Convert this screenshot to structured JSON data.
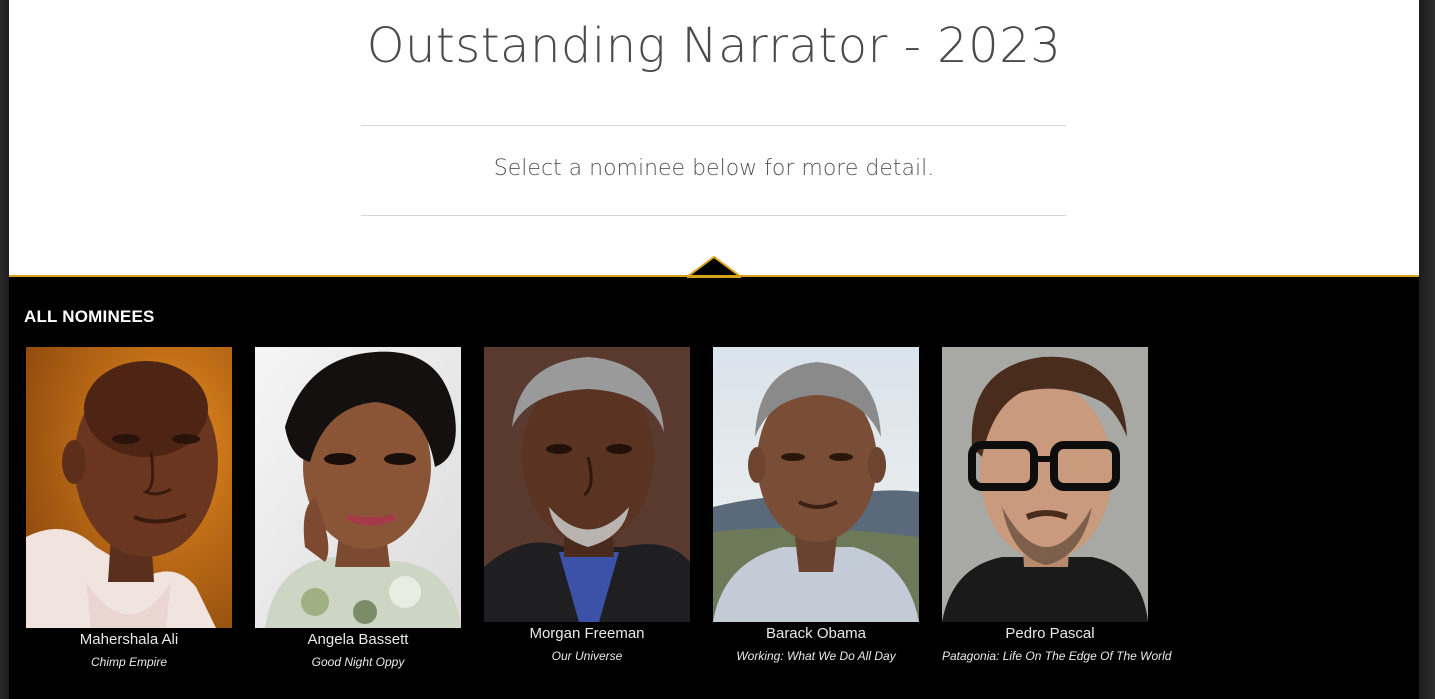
{
  "header": {
    "title": "Outstanding Narrator - 2023",
    "subtitle": "Select a nominee below for more detail."
  },
  "section": {
    "label": "ALL NOMINEES"
  },
  "nominees": [
    {
      "name": "Mahershala Ali",
      "work": "Chimp Empire"
    },
    {
      "name": "Angela Bassett",
      "work": "Good Night Oppy"
    },
    {
      "name": "Morgan Freeman",
      "work": "Our Universe"
    },
    {
      "name": "Barack Obama",
      "work": "Working: What We Do All Day"
    },
    {
      "name": "Pedro Pascal",
      "work": "Patagonia: Life On The Edge Of The World"
    }
  ],
  "colors": {
    "accent": "#d9a21b",
    "header_bg": "#ffffff",
    "body_bg": "#000000"
  }
}
